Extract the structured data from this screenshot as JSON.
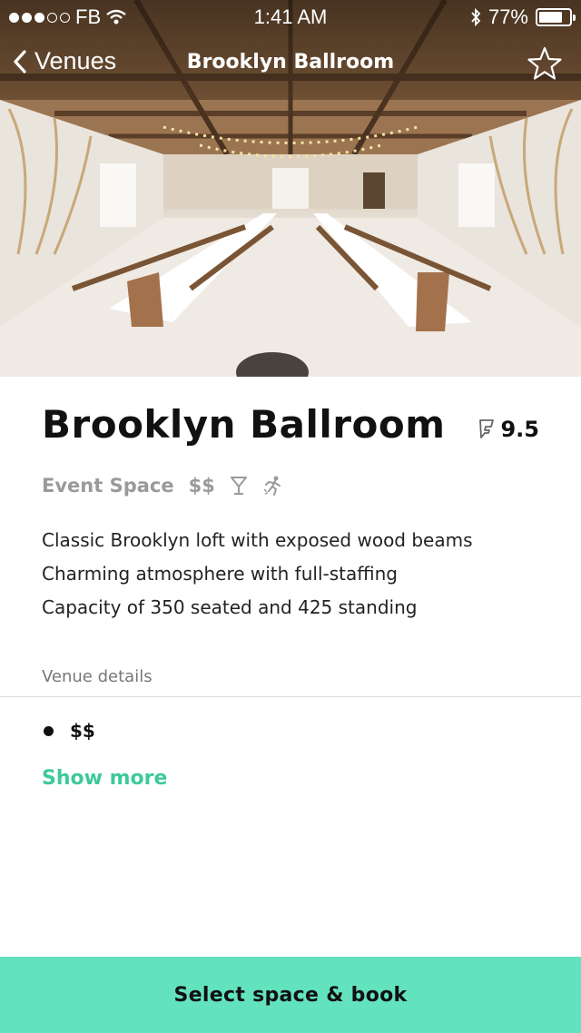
{
  "status_bar": {
    "carrier": "FB",
    "time": "1:41 AM",
    "battery_percent": "77%",
    "battery_level": 0.77,
    "signal_dots_filled": 3,
    "signal_dots_total": 5
  },
  "nav": {
    "back_label": "Venues",
    "title": "Brooklyn Ballroom",
    "favorite_icon": "star-outline-icon"
  },
  "venue": {
    "name": "Brooklyn Ballroom",
    "rating": "9.5",
    "category": "Event Space",
    "price": "$$",
    "amenity_icons": [
      "cocktail-icon",
      "dancing-icon"
    ],
    "description": [
      "Classic Brooklyn loft with exposed wood beams",
      "Charming atmosphere with full-staffing",
      "Capacity of 350 seated and 425 standing"
    ]
  },
  "details": {
    "section_label": "Venue details",
    "items": [
      "$$"
    ],
    "show_more_label": "Show more"
  },
  "cta": {
    "label": "Select space & book"
  },
  "colors": {
    "accent": "#3ec99a",
    "cta_background": "#62e3bd",
    "muted_text": "#9a9a9a"
  }
}
